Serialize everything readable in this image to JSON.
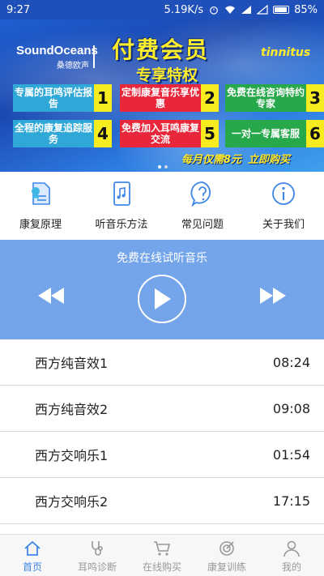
{
  "status_bar": {
    "time": "9:27",
    "network_speed": "5.19K/s",
    "battery": "85%"
  },
  "banner": {
    "brand": "SoundOceans",
    "brand_sub": "桑德欧声",
    "title": "付费会员",
    "subtitle": "专享特权",
    "tag": "tinnitus",
    "benefits": [
      {
        "label": "专属的耳鸣评估报告",
        "num": "1"
      },
      {
        "label": "定制康复音乐享优惠",
        "num": "2"
      },
      {
        "label": "免费在线咨询特约专家",
        "num": "3"
      },
      {
        "label": "全程的康复追踪服务",
        "num": "4"
      },
      {
        "label": "免费加入耳鸣康复交流",
        "num": "5"
      },
      {
        "label": "一对一专属客服",
        "num": "6"
      }
    ],
    "promo": "每月仅需8元",
    "buy": "立即购买"
  },
  "quick_nav": [
    {
      "label": "康复原理",
      "icon": "certificate-icon"
    },
    {
      "label": "听音乐方法",
      "icon": "music-note-icon"
    },
    {
      "label": "常见问题",
      "icon": "question-icon"
    },
    {
      "label": "关于我们",
      "icon": "info-icon"
    }
  ],
  "player": {
    "title": "免费在线试听音乐"
  },
  "tracks": [
    {
      "name": "西方纯音效1",
      "duration": "08:24"
    },
    {
      "name": "西方纯音效2",
      "duration": "09:08"
    },
    {
      "name": "西方交响乐1",
      "duration": "01:54"
    },
    {
      "name": "西方交响乐2",
      "duration": "17:15"
    }
  ],
  "bottom_nav": [
    {
      "label": "首页",
      "icon": "home-icon",
      "active": true
    },
    {
      "label": "耳鸣诊断",
      "icon": "stethoscope-icon",
      "active": false
    },
    {
      "label": "在线购买",
      "icon": "cart-icon",
      "active": false
    },
    {
      "label": "康复训练",
      "icon": "target-icon",
      "active": false
    },
    {
      "label": "我的",
      "icon": "person-icon",
      "active": false
    }
  ],
  "colors": {
    "status_bar": "#1f4fb8",
    "player_bg": "#74a4ea",
    "accent": "#3f86e6",
    "banner_yellow": "#ffec2a"
  }
}
